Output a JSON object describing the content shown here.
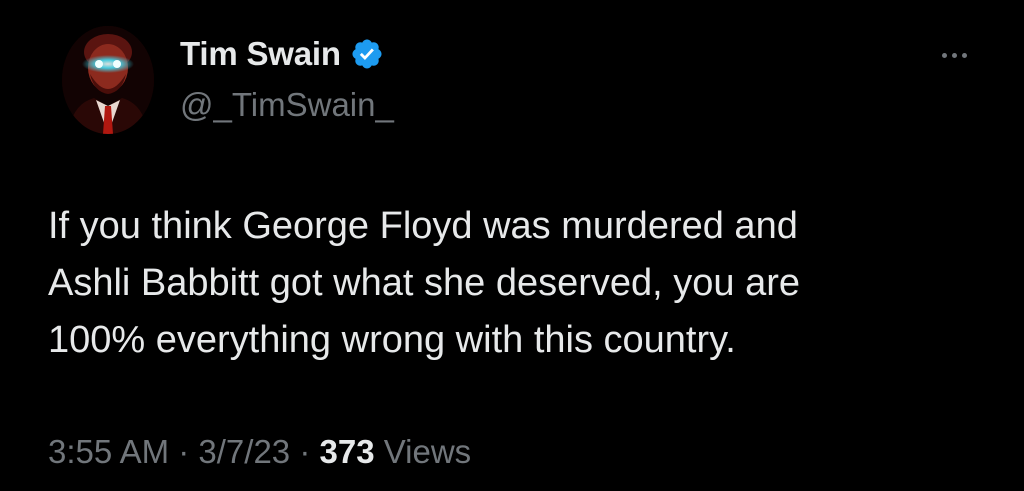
{
  "author": {
    "display_name": "Tim Swain",
    "handle": "@_TimSwain_",
    "verified": true,
    "verified_badge_color": "#1d9bf0",
    "avatar": "avatar-photo"
  },
  "more_icon": "more-horizontal-icon",
  "tweet": {
    "text": "If you think George Floyd was murdered and\nAshli Babbitt got what she deserved, you are\n100% everything wrong with this country."
  },
  "meta": {
    "time": "3:55 AM",
    "separator": " · ",
    "date": "3/7/23",
    "views_count": "373",
    "views_label": " Views"
  },
  "colors": {
    "background": "#000000",
    "primary_text": "#e7e9ea",
    "secondary_text": "#71767b"
  }
}
